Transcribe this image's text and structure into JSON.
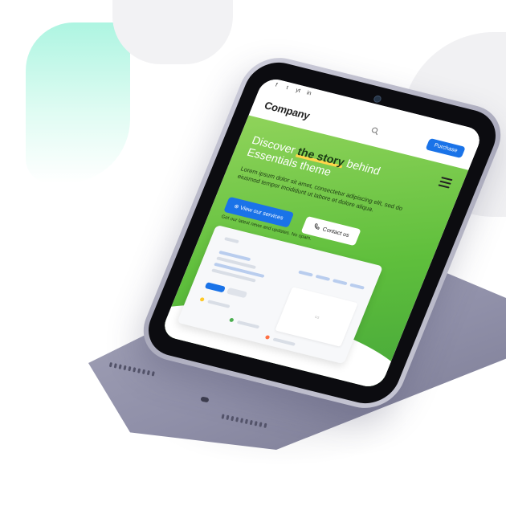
{
  "site": {
    "social": [
      "f",
      "t",
      "yt",
      "in"
    ],
    "logo": "Company",
    "purchase": "Purchase",
    "headline_pre": "Discover",
    "headline_highlight": "the story",
    "headline_post": "behind Essentials theme",
    "lede": "Lorem ipsum dolor sit amet, consectetur adipiscing elit, sed do eiusmod tempor incididunt ut labore et dolore aliqua.",
    "services_button": "View our services",
    "contact_button": "Contact us",
    "newsletter": "Get our latest news and updates. No spam."
  },
  "icons": {
    "search": "search-icon",
    "menu": "hamburger-icon",
    "phone": "phone-icon",
    "arrow": "arrow-right-icon"
  },
  "colors": {
    "accent_blue": "#1a73e8",
    "hero_green": "#5fbf3c",
    "highlight_yellow": "#ffd54a",
    "device_grey": "#9a9ab0"
  }
}
